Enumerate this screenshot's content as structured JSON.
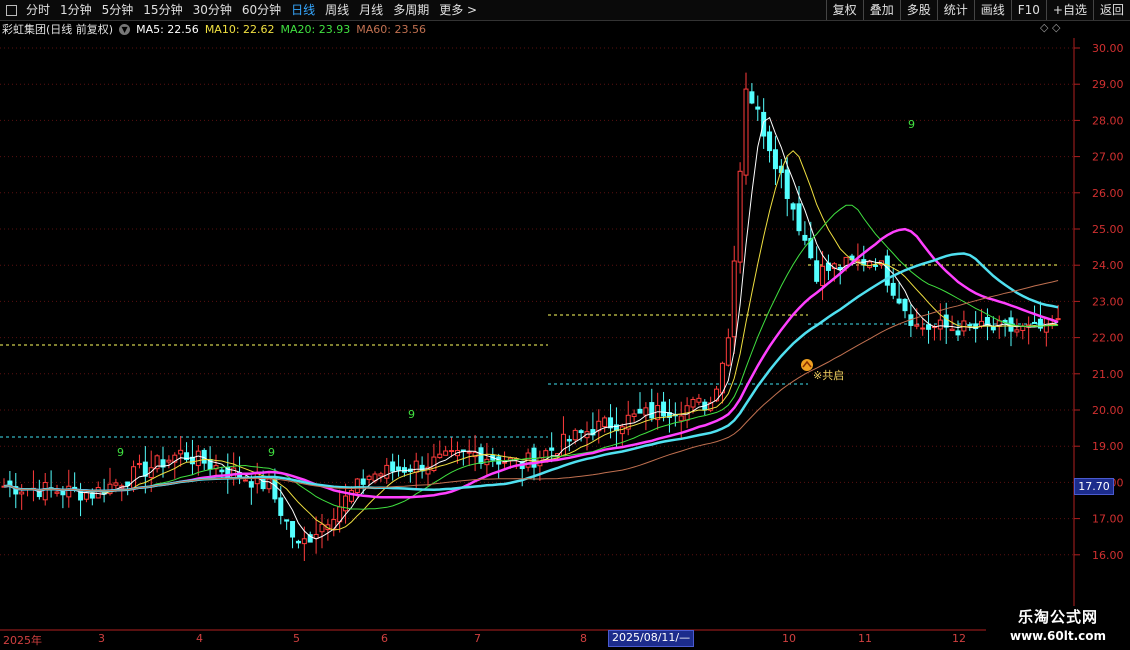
{
  "toolbar": {
    "periods": [
      {
        "label": "分时",
        "active": false
      },
      {
        "label": "1分钟",
        "active": false
      },
      {
        "label": "5分钟",
        "active": false
      },
      {
        "label": "15分钟",
        "active": false
      },
      {
        "label": "30分钟",
        "active": false
      },
      {
        "label": "60分钟",
        "active": false
      },
      {
        "label": "日线",
        "active": true
      },
      {
        "label": "周线",
        "active": false
      },
      {
        "label": "月线",
        "active": false
      },
      {
        "label": "多周期",
        "active": false
      },
      {
        "label": "更多 >",
        "active": false
      }
    ],
    "right_buttons": [
      "复权",
      "叠加",
      "多股",
      "统计",
      "画线",
      "F10",
      "+自选",
      "返回"
    ]
  },
  "info": {
    "stock_title": "彩虹集团(日线 前复权)",
    "ma": [
      {
        "label": "MA5: 22.56",
        "color": "#ffffff"
      },
      {
        "label": "MA10: 22.62",
        "color": "#f0e040"
      },
      {
        "label": "MA20: 23.93",
        "color": "#40e040"
      },
      {
        "label": "MA60: 23.56",
        "color": "#c07050"
      }
    ],
    "right_icons": "◇ ◇"
  },
  "price_axis": {
    "ticks": [
      "30.00",
      "29.00",
      "28.00",
      "27.00",
      "26.00",
      "25.00",
      "24.00",
      "23.00",
      "22.00",
      "21.00",
      "20.00",
      "19.00",
      "18.00",
      "17.00",
      "16.00"
    ],
    "min": 15.4,
    "max": 30.3,
    "current_price": "17.70"
  },
  "date_axis": {
    "months": [
      "2025年",
      "3",
      "4",
      "5",
      "6",
      "7",
      "8",
      "10",
      "11",
      "12"
    ],
    "highlighted_date": "2025/08/11/—"
  },
  "annotations": {
    "nine_marks": [
      "9",
      "9",
      "9",
      "9"
    ],
    "signal_label": "※共启"
  },
  "watermark": {
    "line1": "乐淘公式网",
    "line2": "www.60lt.com"
  },
  "colors": {
    "up": "#ff3c3c",
    "down": "#54ffff",
    "ma_white": "#ffffff",
    "ma_yellow": "#f0e040",
    "ma_green": "#40e040",
    "ma_pink": "#ff40ff",
    "ma_cyan": "#50e0f0",
    "ma_brown": "#c07050"
  },
  "chart_data": {
    "type": "candlestick",
    "y_range": [
      15.4,
      30.3
    ],
    "bars": 180,
    "segments": [
      {
        "from": 0,
        "to": 15,
        "start": 17.9,
        "end": 17.7
      },
      {
        "from": 15,
        "to": 30,
        "start": 17.7,
        "end": 18.8
      },
      {
        "from": 30,
        "to": 45,
        "start": 18.8,
        "end": 17.9
      },
      {
        "from": 45,
        "to": 50,
        "start": 17.9,
        "end": 16.2
      },
      {
        "from": 50,
        "to": 62,
        "start": 16.2,
        "end": 18.2
      },
      {
        "from": 62,
        "to": 80,
        "start": 18.2,
        "end": 18.8
      },
      {
        "from": 80,
        "to": 88,
        "start": 18.8,
        "end": 18.5
      },
      {
        "from": 88,
        "to": 100,
        "start": 18.5,
        "end": 19.5
      },
      {
        "from": 100,
        "to": 112,
        "start": 19.5,
        "end": 20.0
      },
      {
        "from": 112,
        "to": 120,
        "start": 20.0,
        "end": 20.2
      },
      {
        "from": 120,
        "to": 123,
        "start": 20.2,
        "end": 22.0
      },
      {
        "from": 123,
        "to": 126,
        "start": 22.0,
        "end": 29.0
      },
      {
        "from": 126,
        "to": 132,
        "start": 29.0,
        "end": 26.5
      },
      {
        "from": 132,
        "to": 138,
        "start": 26.5,
        "end": 23.8
      },
      {
        "from": 138,
        "to": 148,
        "start": 23.8,
        "end": 24.2
      },
      {
        "from": 148,
        "to": 155,
        "start": 24.2,
        "end": 22.3
      },
      {
        "from": 155,
        "to": 175,
        "start": 22.3,
        "end": 22.2
      },
      {
        "from": 175,
        "to": 180,
        "start": 22.2,
        "end": 22.4
      }
    ]
  }
}
